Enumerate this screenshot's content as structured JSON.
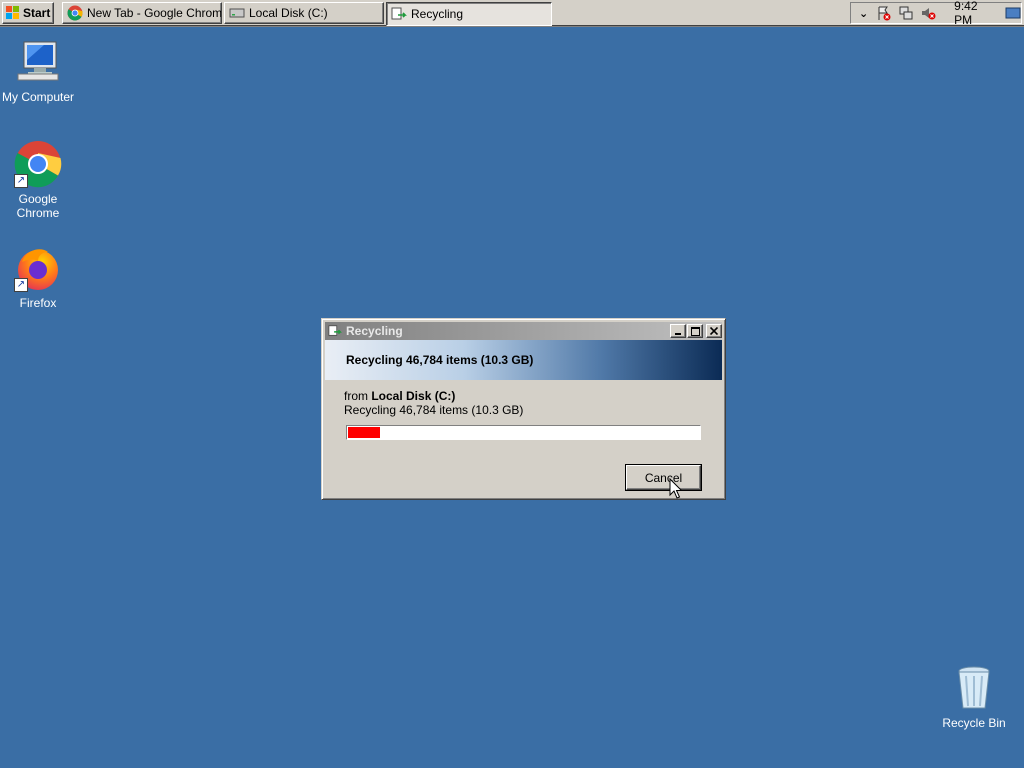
{
  "taskbar": {
    "start_label": "Start",
    "tasks": [
      {
        "label": "New Tab - Google Chrome",
        "icon": "chrome-icon"
      },
      {
        "label": "Local Disk (C:)",
        "icon": "drive-icon"
      },
      {
        "label": "Recycling",
        "icon": "recycle-icon"
      }
    ],
    "tray": {
      "clock": "9:42 PM",
      "icons": [
        "show-hidden-icons-chevron",
        "action-center-flag-icon",
        "network-icon",
        "volume-muted-icon"
      ]
    }
  },
  "desktop": {
    "icons": [
      {
        "label": "My Computer",
        "icon": "my-computer-icon"
      },
      {
        "label": "Google Chrome",
        "icon": "chrome-icon"
      },
      {
        "label": "Firefox",
        "icon": "firefox-icon"
      },
      {
        "label": "Recycle Bin",
        "icon": "recycle-bin-icon"
      }
    ]
  },
  "dialog": {
    "title": "Recycling",
    "banner": "Recycling 46,784 items (10.3 GB)",
    "from_prefix": "from",
    "from_location": "Local Disk (C:)",
    "detail": "Recycling 46,784 items (10.3 GB)",
    "progress_fraction": 0.09,
    "cancel_label": "Cancel"
  },
  "colors": {
    "desktop_bg": "#3a6ea5",
    "progress_fill": "#ff0000",
    "chrome_face": "#d4d0c8"
  }
}
